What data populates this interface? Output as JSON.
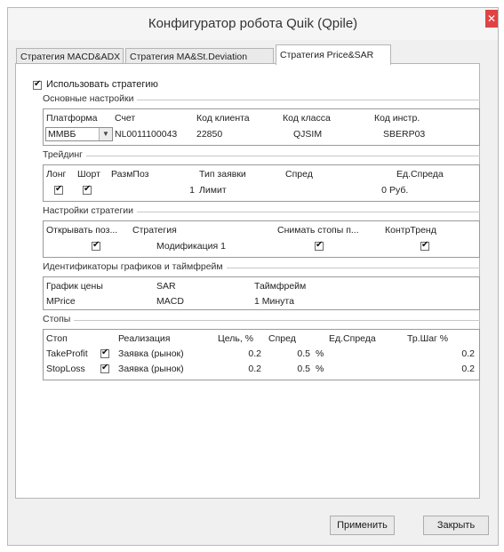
{
  "window": {
    "title": "Конфигуратор робота Quik (Qpile)",
    "close_icon": "close-icon"
  },
  "tabs": [
    {
      "label": "Стратегия MACD&ADX",
      "active": false
    },
    {
      "label": "Стратегия MA&St.Deviation",
      "active": false
    },
    {
      "label": "Стратегия Price&SAR",
      "active": true
    }
  ],
  "use_strategy": {
    "label": "Использовать стратегию",
    "checked": true
  },
  "basic": {
    "title": "Основные настройки",
    "headers": [
      "Платформа",
      "Счет",
      "Код клиента",
      "Код класса",
      "Код инстр."
    ],
    "values": {
      "platform": "MMBБ",
      "account": "NL0011100043",
      "client_code": "22850",
      "class_code": "QJSIM",
      "instr_code": "SBERP03"
    }
  },
  "trading": {
    "title": "Трейдинг",
    "headers": [
      "Лонг",
      "Шорт",
      "РазмПоз",
      "Тип заявки",
      "Спред",
      "Ед.Спреда"
    ],
    "values": {
      "long": true,
      "short": true,
      "pos_size": "1",
      "order_type": "Лимит",
      "spread": "0",
      "spread_unit": "Руб."
    }
  },
  "strategy_settings": {
    "title": "Настройки стратегии",
    "headers": [
      "Открывать поз...",
      "Стратегия",
      "Снимать стопы п...",
      "КонтрТренд"
    ],
    "values": {
      "open_pos": true,
      "strategy": "Модификация 1",
      "remove_stops": true,
      "counter_trend": true
    }
  },
  "identifiers": {
    "title": "Идентификаторы графиков и таймфрейм",
    "headers": [
      "График цены",
      "SAR",
      "Таймфрейм"
    ],
    "values": {
      "price_chart": "MPrice",
      "sar": "MACD",
      "timeframe": "1 Минута"
    }
  },
  "stops": {
    "title": "Стопы",
    "headers": [
      "Стоп",
      "Реализация",
      "Цель, %",
      "Спред",
      "Ед.Спреда",
      "Тр.Шаг %"
    ],
    "rows": [
      {
        "name": "TakeProfit",
        "checked": true,
        "realization": "Заявка (рынок)",
        "target": "0.2",
        "spread": "0.5",
        "unit": "%",
        "trail": "0.2"
      },
      {
        "name": "StopLoss",
        "checked": true,
        "realization": "Заявка (рынок)",
        "target": "0.2",
        "spread": "0.5",
        "unit": "%",
        "trail": "0.2"
      }
    ]
  },
  "buttons": {
    "apply": "Применить",
    "close": "Закрыть"
  }
}
